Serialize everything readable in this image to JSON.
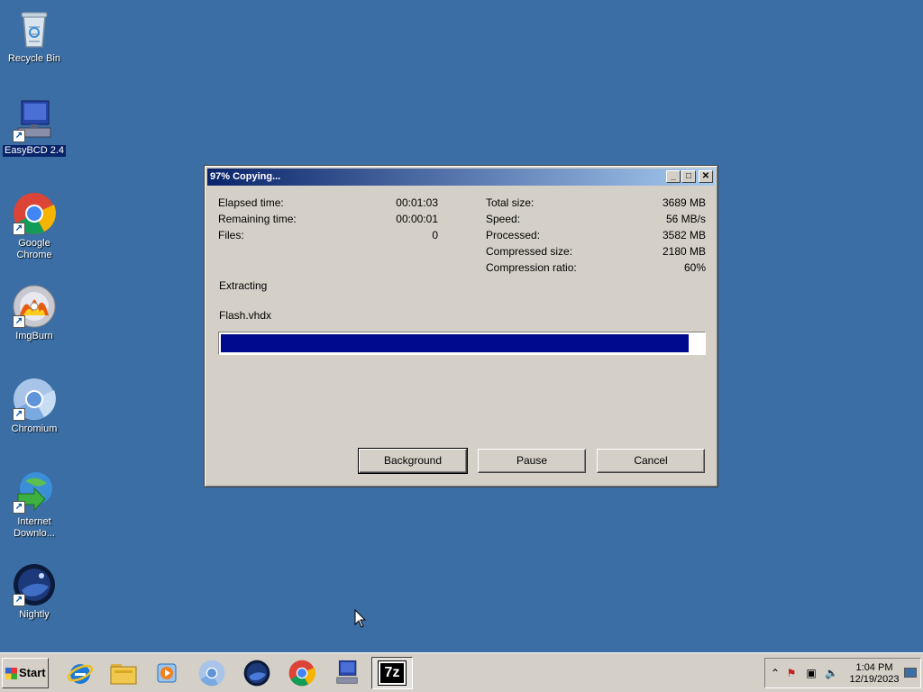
{
  "desktop": {
    "icons": [
      {
        "label": "Recycle Bin"
      },
      {
        "label": "EasyBCD 2.4"
      },
      {
        "label": "Google Chrome"
      },
      {
        "label": "ImgBurn"
      },
      {
        "label": "Chromium"
      },
      {
        "label": "Internet Downlo..."
      },
      {
        "label": "Nightly"
      }
    ]
  },
  "dialog": {
    "title": "97% Copying...",
    "buttons": {
      "minimize": "_",
      "maximize": "□",
      "close": "✕"
    },
    "left_stats": [
      {
        "label": "Elapsed time:",
        "value": "00:01:03"
      },
      {
        "label": "Remaining time:",
        "value": "00:00:01"
      },
      {
        "label": "Files:",
        "value": "0"
      }
    ],
    "right_stats": [
      {
        "label": "Total size:",
        "value": "3689 MB"
      },
      {
        "label": "Speed:",
        "value": "56 MB/s"
      },
      {
        "label": "Processed:",
        "value": "3582 MB"
      },
      {
        "label": "Compressed size:",
        "value": "2180 MB"
      },
      {
        "label": "Compression ratio:",
        "value": "60%"
      }
    ],
    "operation": "Extracting",
    "current_file": "Flash.vhdx",
    "progress_percent": 97,
    "actions": {
      "background": "Background",
      "pause": "Pause",
      "cancel": "Cancel"
    }
  },
  "taskbar": {
    "start_label": "Start",
    "items": [
      {
        "icon": "internet-explorer-icon"
      },
      {
        "icon": "file-explorer-icon"
      },
      {
        "icon": "media-player-icon"
      },
      {
        "icon": "chromium-icon"
      },
      {
        "icon": "nightly-icon"
      },
      {
        "icon": "chrome-icon"
      },
      {
        "icon": "easybcd-icon"
      },
      {
        "icon": "7zip-icon",
        "text": "7z"
      }
    ],
    "clock": {
      "time": "1:04 PM",
      "date": "12/19/2023"
    }
  }
}
